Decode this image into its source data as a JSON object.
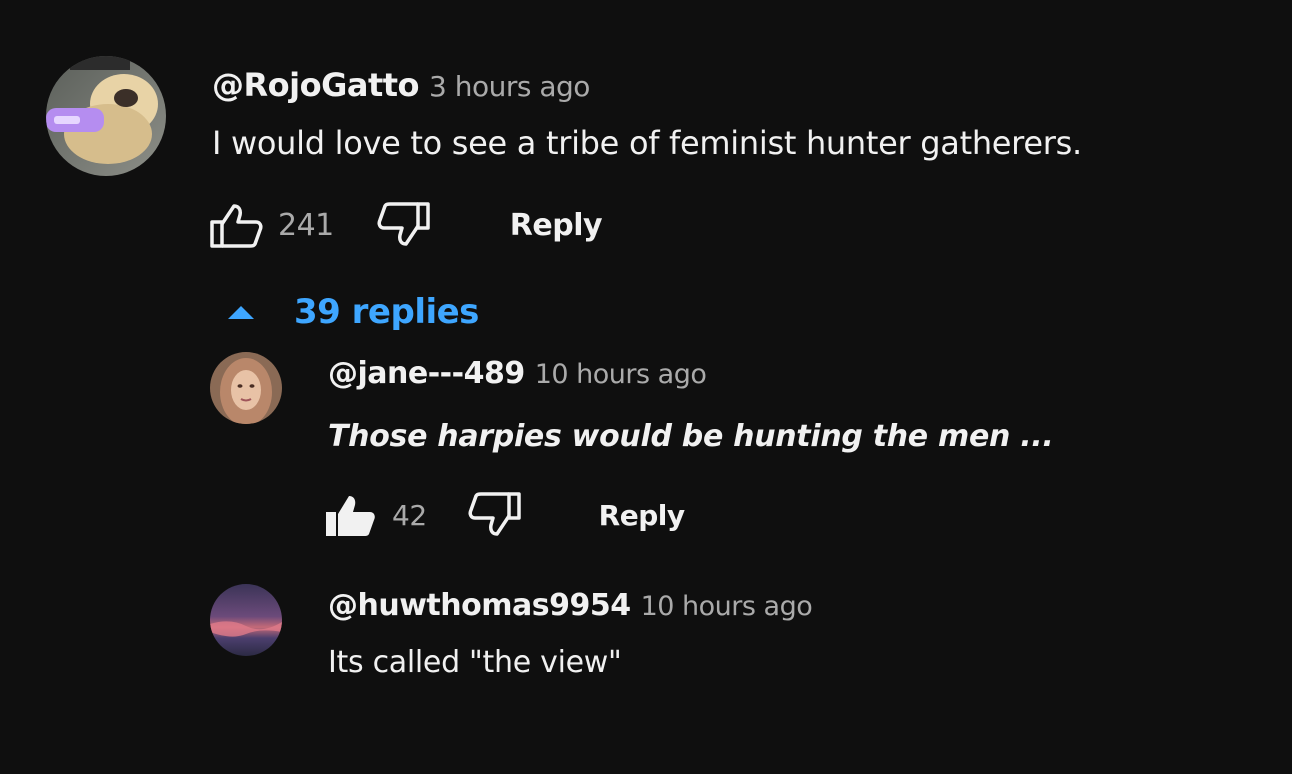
{
  "comment": {
    "author": "@RojoGatto",
    "time": "3 hours ago",
    "text": "I would love to see a tribe of feminist hunter gatherers.",
    "likes": "241",
    "reply_label": "Reply",
    "liked": false
  },
  "replies_toggle": {
    "label": "39 replies",
    "icon": "chevron-up-icon",
    "color": "#3ea6ff"
  },
  "replies": [
    {
      "author": "@jane---489",
      "time": "10 hours ago",
      "text": "Those harpies would be hunting the men ...",
      "likes": "42",
      "reply_label": "Reply",
      "liked": true
    },
    {
      "author": "@huwthomas9954",
      "time": "10 hours ago",
      "text": "Its called \"the view\""
    }
  ],
  "colors": {
    "background": "#0f0f0f",
    "text_primary": "#f1f1f1",
    "text_secondary": "#aaaaaa",
    "link": "#3ea6ff"
  }
}
